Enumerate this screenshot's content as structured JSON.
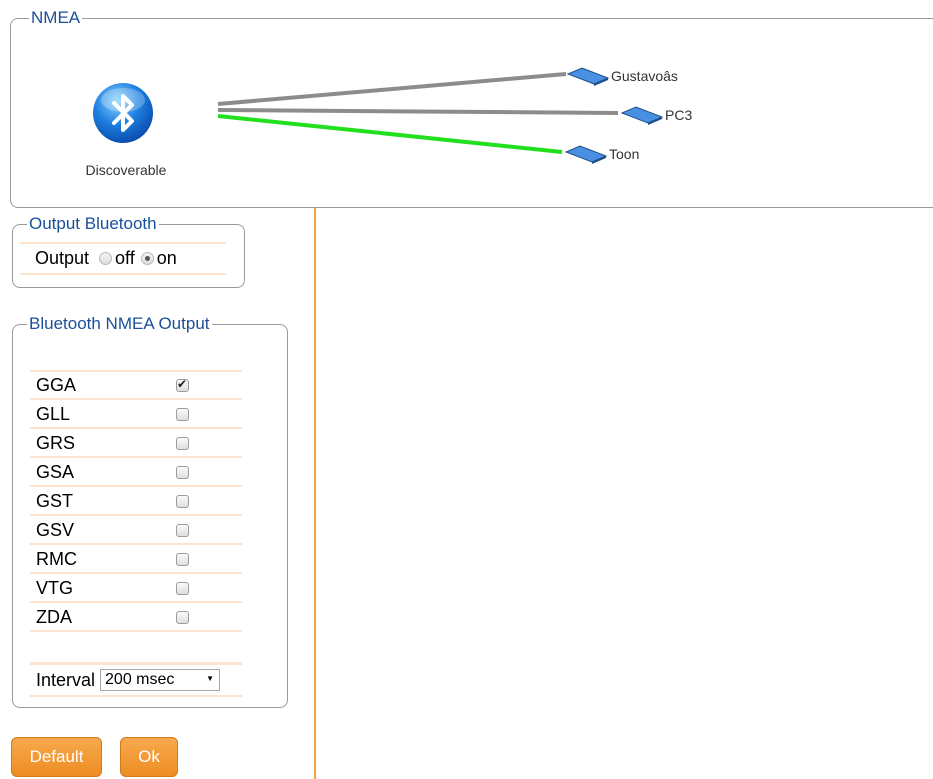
{
  "nmea_panel": {
    "legend": "NMEA",
    "status_label": "Discoverable",
    "devices": [
      {
        "name": "Gustavoâs",
        "connected": false
      },
      {
        "name": "PC3",
        "connected": false
      },
      {
        "name": "Toon",
        "connected": true
      }
    ],
    "colors": {
      "connected": "#22e01e",
      "disconnected": "#8c8c8c"
    }
  },
  "output_bluetooth": {
    "legend": "Output Bluetooth",
    "label": "Output",
    "options": [
      {
        "label": "off",
        "checked": false
      },
      {
        "label": "on",
        "checked": true
      }
    ]
  },
  "bluetooth_nmea_output": {
    "legend": "Bluetooth NMEA Output",
    "sentences": [
      {
        "label": "GGA",
        "checked": true
      },
      {
        "label": "GLL",
        "checked": false
      },
      {
        "label": "GRS",
        "checked": false
      },
      {
        "label": "GSA",
        "checked": false
      },
      {
        "label": "GST",
        "checked": false
      },
      {
        "label": "GSV",
        "checked": false
      },
      {
        "label": "RMC",
        "checked": false
      },
      {
        "label": "VTG",
        "checked": false
      },
      {
        "label": "ZDA",
        "checked": false
      }
    ],
    "interval_label": "Interval",
    "interval_value": "200 msec"
  },
  "buttons": {
    "default_label": "Default",
    "ok_label": "Ok"
  },
  "accent_color": "#f0a24a"
}
